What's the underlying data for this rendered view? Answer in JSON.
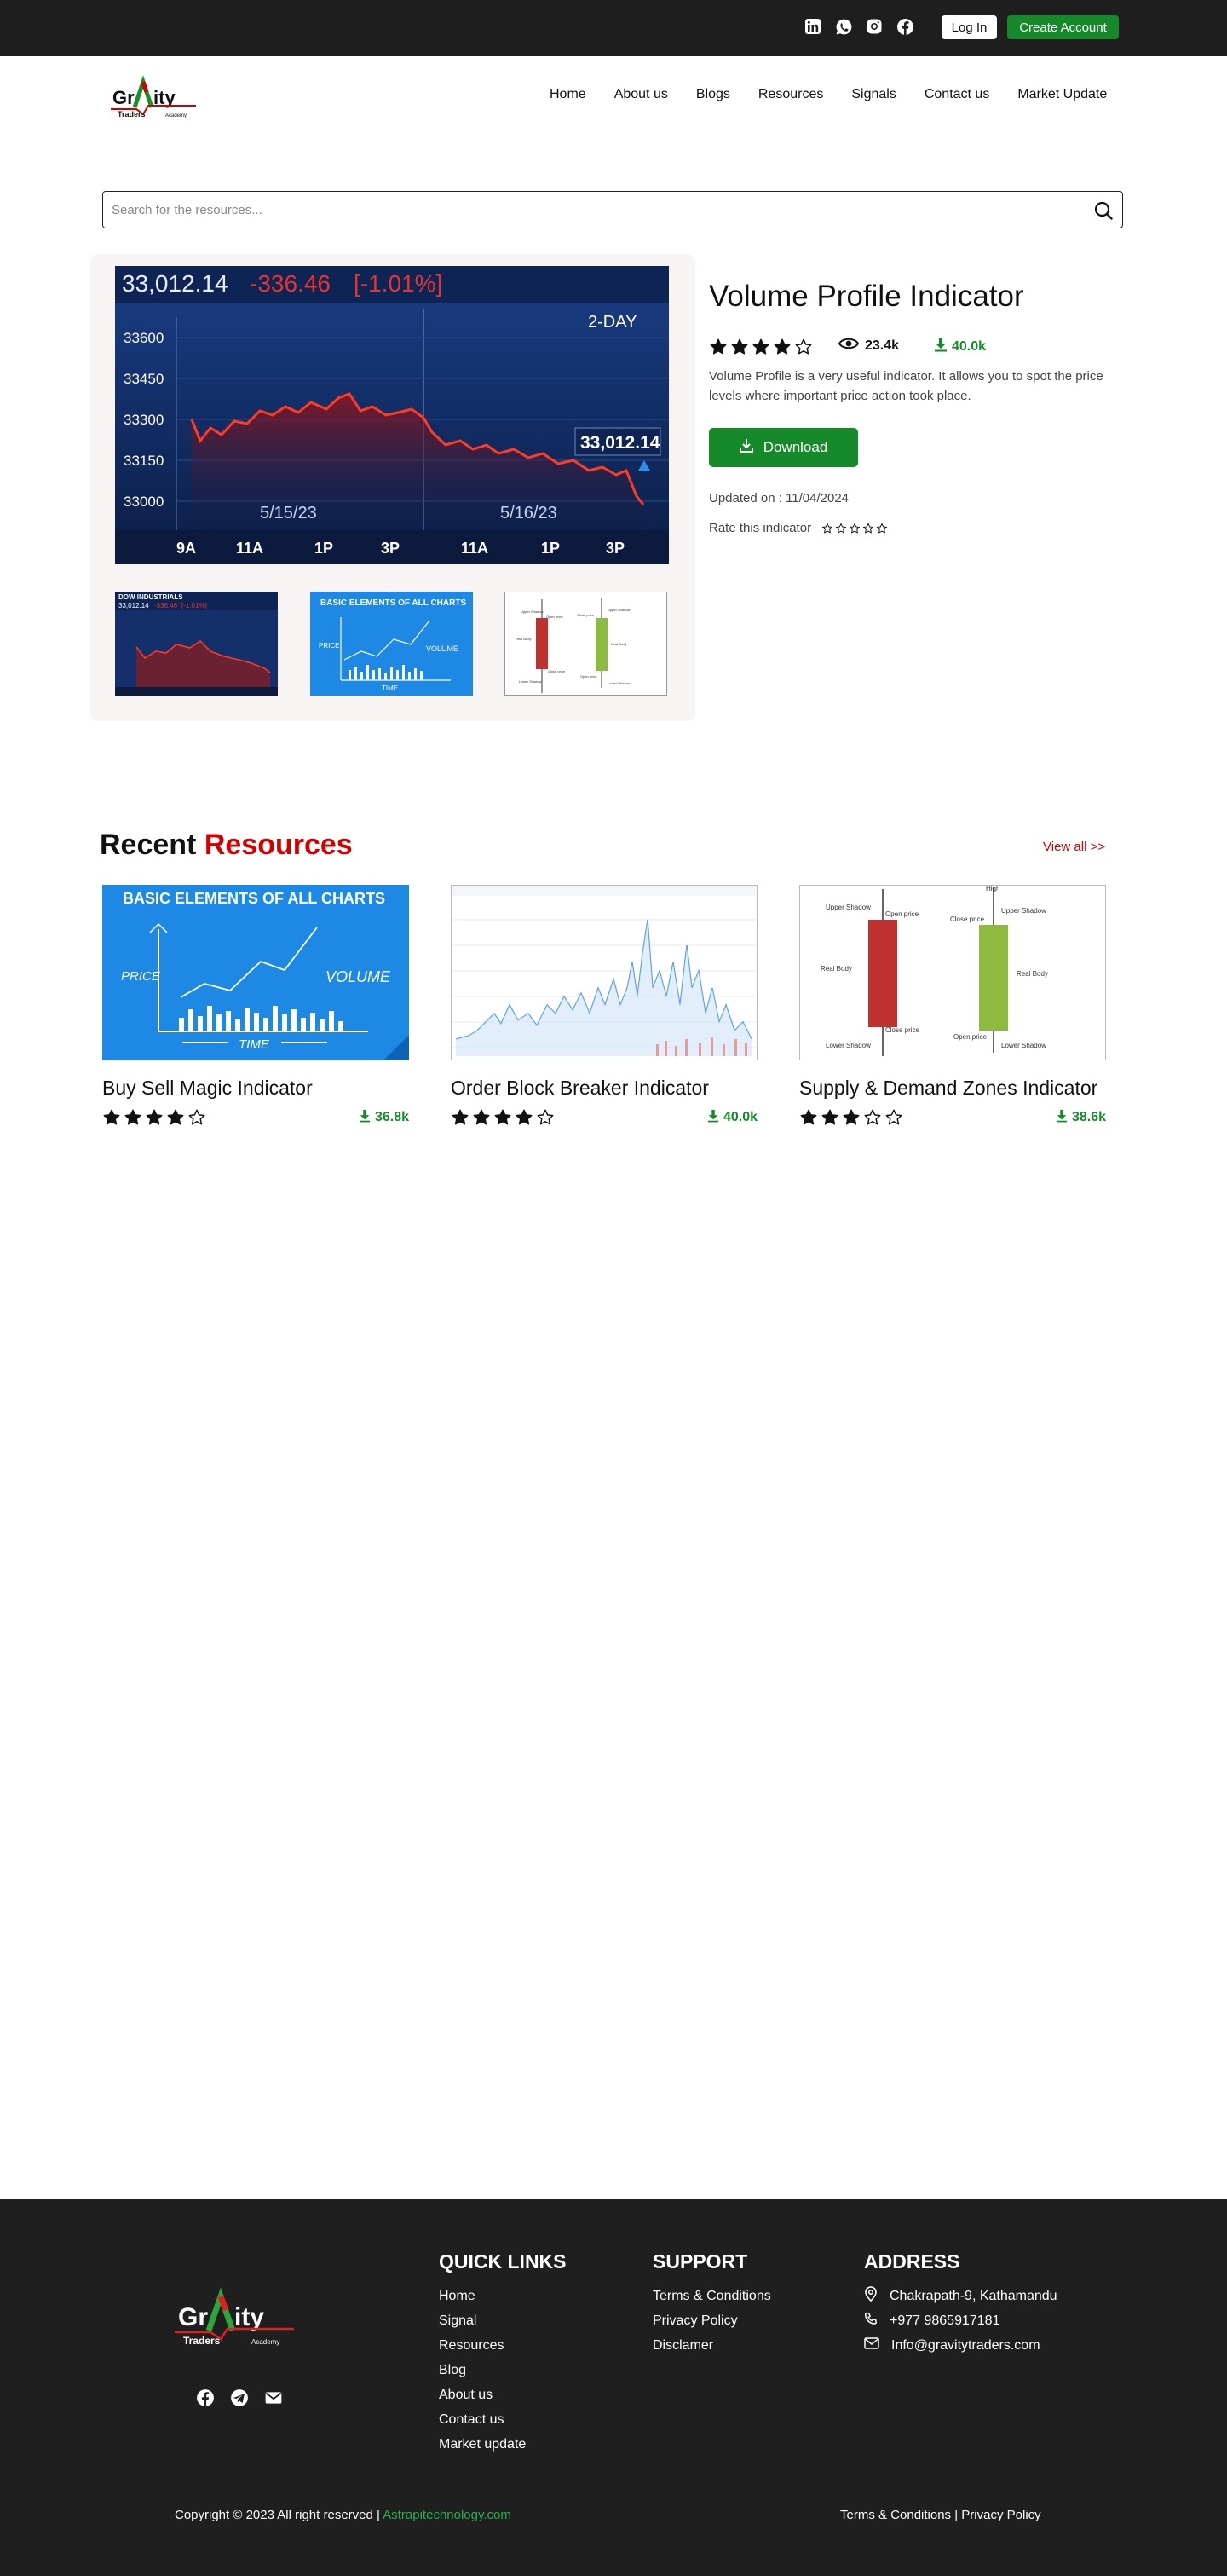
{
  "header": {
    "social_icons": [
      "linkedin-icon",
      "whatsapp-icon",
      "instagram-icon",
      "facebook-icon"
    ],
    "login_label": "Log In",
    "create_account_label": "Create Account"
  },
  "brand": {
    "logo_main": "GrAVity",
    "logo_sub": "Traders",
    "logo_sub2": "Academy"
  },
  "nav": [
    "Home",
    "About us",
    "Blogs",
    "Resources",
    "Signals",
    "Contact us",
    "Market Update"
  ],
  "search": {
    "placeholder": "Search for the resources..."
  },
  "product": {
    "title": "Volume Profile Indicator",
    "rating": 4,
    "views": "23.4k",
    "downloads": "40.0k",
    "description": "Volume Profile is a very useful indicator. It allows you to spot the price levels where important price action took place.",
    "download_label": "Download",
    "updated": "Updated on : 11/04/2024",
    "rate_label": "Rate this indicator",
    "main_image": {
      "price": "33,012.14",
      "change": "-336.46",
      "pct": "[-1.01%]",
      "range": "2-DAY",
      "y_ticks": [
        "33600",
        "33450",
        "33300",
        "33150",
        "33000"
      ],
      "dates": [
        "5/15/23",
        "5/16/23"
      ],
      "x_ticks": [
        "9A",
        "11A",
        "1P",
        "3P",
        "11A",
        "1P",
        "3P"
      ],
      "last_label": "33,012.14"
    },
    "thumbs": {
      "t1_title": "DOW INDUSTRIALS",
      "t2_title": "BASIC ELEMENTS OF ALL CHARTS"
    }
  },
  "recent": {
    "title_a": "Recent",
    "title_b": "Resources",
    "view_all": "View all >>",
    "cards": [
      {
        "title": "Buy Sell Magic Indicator",
        "rating": 4,
        "downloads": "36.8k"
      },
      {
        "title": "Order Block Breaker Indicator",
        "rating": 4,
        "downloads": "40.0k"
      },
      {
        "title": "Supply & Demand Zones Indicator",
        "rating": 3,
        "downloads": "38.6k"
      }
    ],
    "basic_chart": {
      "title": "BASIC ELEMENTS OF ALL CHARTS",
      "price": "PRICE",
      "volume": "VOLUME",
      "time": "TIME"
    },
    "candle": {
      "upper_shadow": "Upper Shadow",
      "open_price": "Open price",
      "real_body": "Real Body",
      "close_price": "Close price",
      "lower_shadow": "Lower Shadow",
      "high": "High"
    }
  },
  "footer": {
    "quick_links_title": "QUICK LINKS",
    "quick_links": [
      "Home",
      "Signal",
      "Resources",
      "Blog",
      "About us",
      "Contact us",
      "Market update"
    ],
    "support_title": "SUPPORT",
    "support": [
      "Terms & Conditions",
      "Privacy Policy",
      "Disclamer"
    ],
    "address_title": "ADDRESS",
    "address": "Chakrapath-9, Kathamandu",
    "phone": "+977 9865917181",
    "email": "Info@gravitytraders.com",
    "copyright": "Copyright © 2023 All right reserved |",
    "credit": "Astrapitechnology.com",
    "terms": "Terms & Conditions |",
    "privacy": "Privacy Policy",
    "social_icons": [
      "facebook-icon",
      "telegram-icon",
      "mail-icon"
    ]
  }
}
